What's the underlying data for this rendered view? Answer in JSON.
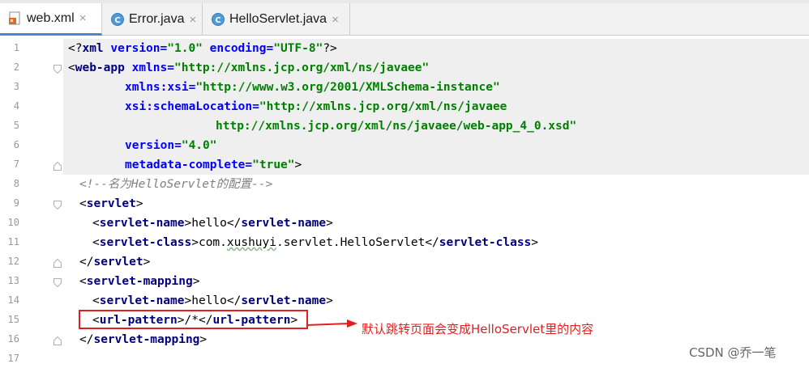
{
  "tabs": [
    {
      "label": "web.xml",
      "active": true,
      "icon": "xml-file-icon"
    },
    {
      "label": "Error.java",
      "active": false,
      "icon": "java-class-icon"
    },
    {
      "label": "HelloServlet.java",
      "active": false,
      "icon": "java-class-icon"
    }
  ],
  "close_glyph": "×",
  "line_numbers": [
    "1",
    "2",
    "3",
    "4",
    "5",
    "6",
    "7",
    "8",
    "9",
    "10",
    "11",
    "12",
    "13",
    "14",
    "15",
    "16",
    "17"
  ],
  "code": {
    "l1": {
      "open": "<?",
      "name": "xml",
      "a1": "version=",
      "v1": "\"1.0\"",
      "a2": "encoding=",
      "v2": "\"UTF-8\"",
      "close": "?>"
    },
    "l2": {
      "open": "<",
      "name": "web-app",
      "a1": "xmlns=",
      "v1": "\"http://xmlns.jcp.org/xml/ns/javaee\""
    },
    "l3": {
      "a1": "xmlns:xsi=",
      "v1": "\"http://www.w3.org/2001/XMLSchema-instance\""
    },
    "l4": {
      "a1": "xsi:schemaLocation=",
      "v1": "\"http://xmlns.jcp.org/xml/ns/javaee"
    },
    "l5": {
      "v1": "http://xmlns.jcp.org/xml/ns/javaee/web-app_4_0.xsd\""
    },
    "l6": {
      "a1": "version=",
      "v1": "\"4.0\""
    },
    "l7": {
      "a1": "metadata-complete=",
      "v1": "\"true\"",
      "close": ">"
    },
    "l8": {
      "comment": "<!--名为HelloServlet的配置-->"
    },
    "l9": {
      "name": "servlet"
    },
    "l10": {
      "name": "servlet-name",
      "text": "hello"
    },
    "l11": {
      "name": "servlet-class",
      "text1": "com.",
      "text_u": "xushuyi",
      "text2": ".servlet.HelloServlet"
    },
    "l12": {
      "name": "servlet"
    },
    "l13": {
      "name": "servlet-mapping"
    },
    "l14": {
      "name": "servlet-name",
      "text": "hello"
    },
    "l15": {
      "name": "url-pattern",
      "text": "/*"
    },
    "l16": {
      "name": "servlet-mapping"
    }
  },
  "annotation": "默认跳转页面会变成HelloServlet里的内容",
  "watermark": "CSDN @乔一笔",
  "colors": {
    "tag": "#000080",
    "attr": "#0000ff",
    "value": "#008000",
    "comment": "#808080",
    "annotation": "#e02020"
  }
}
